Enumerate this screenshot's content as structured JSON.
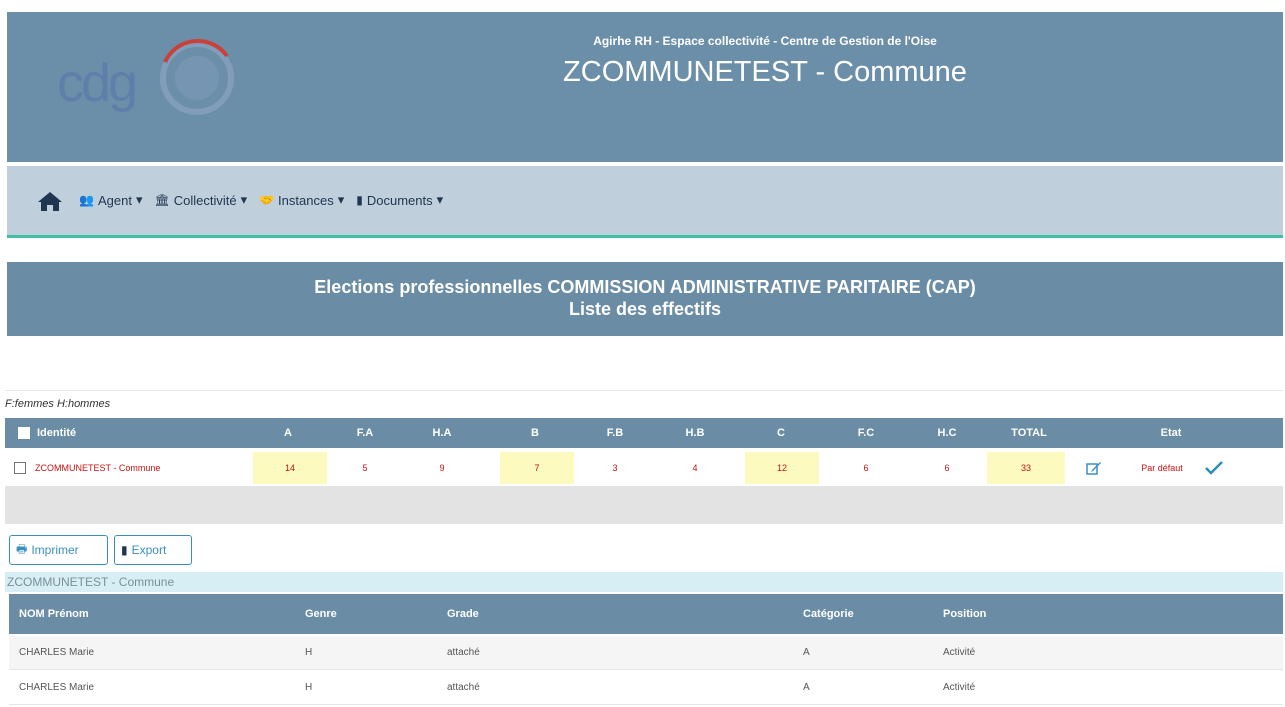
{
  "header": {
    "logo_text": "cdg",
    "subtitle": "Agirhe RH - Espace collectivité - Centre de Gestion de l'Oise",
    "title": "ZCOMMUNETEST - Commune"
  },
  "nav": {
    "home_icon": "home-icon",
    "items": [
      {
        "label": "Agent",
        "icon": "users-icon"
      },
      {
        "label": "Collectivité",
        "icon": "institution-icon"
      },
      {
        "label": "Instances",
        "icon": "handshake-icon"
      },
      {
        "label": "Documents",
        "icon": "file-icon"
      }
    ]
  },
  "banner": {
    "line1": "Elections professionnelles COMMISSION ADMINISTRATIVE PARITAIRE (CAP)",
    "line2": "Liste des effectifs"
  },
  "legend": "F:femmes H:hommes",
  "effectifs": {
    "headers": [
      "Identité",
      "A",
      "F.A",
      "H.A",
      "B",
      "F.B",
      "H.B",
      "C",
      "F.C",
      "H.C",
      "TOTAL",
      "Etat"
    ],
    "row": {
      "identite": "ZCOMMUNETEST - Commune",
      "values": [
        "14",
        "5",
        "9",
        "7",
        "3",
        "4",
        "12",
        "6",
        "6",
        "33"
      ],
      "etat": "Par défaut"
    }
  },
  "buttons": {
    "print": "Imprimer",
    "export": "Export"
  },
  "commune_label": "ZCOMMUNETEST - Commune",
  "list": {
    "headers": [
      "NOM Prénom",
      "Genre",
      "Grade",
      "Catégorie",
      "Position"
    ],
    "rows": [
      [
        "CHARLES Marie",
        "H",
        "attaché",
        "A",
        "Activité"
      ],
      [
        "CHARLES Marie",
        "H",
        "attaché",
        "A",
        "Activité"
      ]
    ]
  },
  "colors": {
    "header_bg": "#6c8fa9",
    "nav_bg": "#bfcfdb",
    "accent_line": "#3fbfa5",
    "red_text": "#cc1111",
    "highlight": "#fdfac0"
  }
}
